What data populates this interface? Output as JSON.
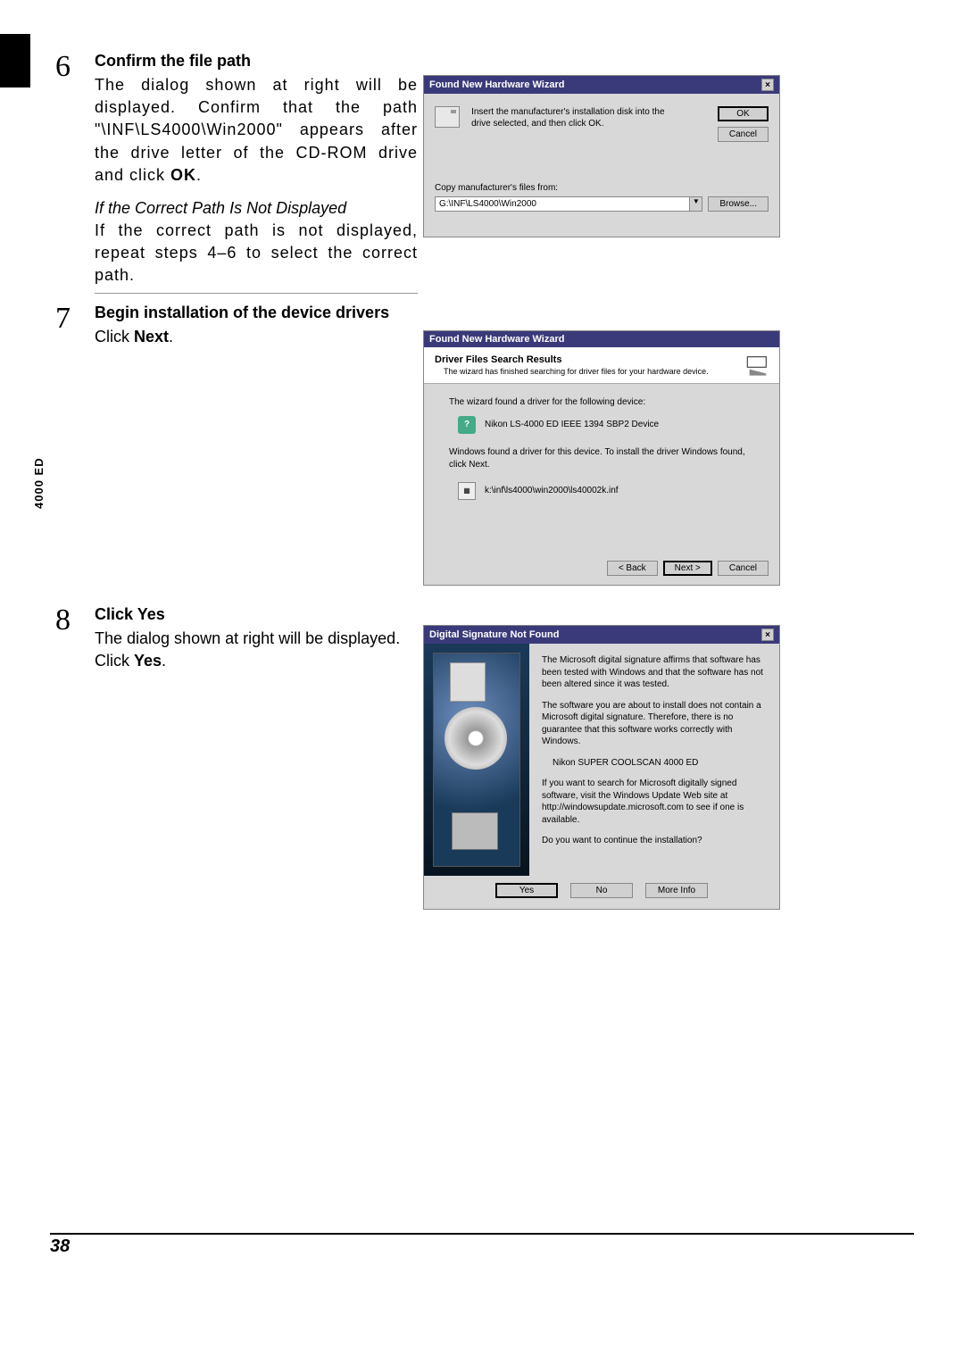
{
  "side_label": "4000 ED",
  "page_number": "38",
  "step6": {
    "num": "6",
    "title": "Confirm the file path",
    "body_prefix": "The dialog shown at right will be displayed. Confirm that the path \"\\INF\\LS4000\\Win2000\" appears after the drive letter of the CD-ROM drive and click ",
    "body_bold": "OK",
    "body_suffix": ".",
    "italic_heading": "If the Correct Path Is Not Displayed",
    "italic_body": "If the correct path is not displayed, repeat steps 4–6 to select the correct path."
  },
  "step7": {
    "num": "7",
    "title": "Begin installation of the device drivers",
    "body_prefix": "Click ",
    "body_bold": "Next",
    "body_suffix": "."
  },
  "step8": {
    "num": "8",
    "title_prefix": "Click ",
    "title_bold": "Yes",
    "body_prefix": "The dialog shown at right will be displayed. Click ",
    "body_bold": "Yes",
    "body_suffix": "."
  },
  "dlg1": {
    "title": "Found New Hardware Wizard",
    "instruction": "Insert the manufacturer's installation disk into the drive selected, and then click OK.",
    "ok": "OK",
    "cancel": "Cancel",
    "copy_label": "Copy manufacturer's files from:",
    "path_value": "G:\\INF\\LS4000\\Win2000",
    "browse": "Browse..."
  },
  "dlg2": {
    "title": "Found New Hardware Wizard",
    "header_title": "Driver Files Search Results",
    "header_sub": "The wizard has finished searching for driver files for your hardware device.",
    "found_text": "The wizard found a driver for the following device:",
    "device_name": "Nikon   LS-4000 ED      IEEE 1394 SBP2 Device",
    "install_text": "Windows found a driver for this device. To install the driver Windows found, click Next.",
    "inf_path": "k:\\inf\\ls4000\\win2000\\ls40002k.inf",
    "back": "< Back",
    "next": "Next >",
    "cancel": "Cancel"
  },
  "dlg3": {
    "title": "Digital Signature Not Found",
    "p1": "The Microsoft digital signature affirms that software has been tested with Windows and that the software has not been altered since it was tested.",
    "p2": "The software you are about to install does not contain a Microsoft digital signature. Therefore, there is no guarantee that this software works correctly with Windows.",
    "product": "Nikon SUPER COOLSCAN 4000 ED",
    "p3": "If you want to search for Microsoft digitally signed software, visit the Windows Update Web site at http://windowsupdate.microsoft.com to see if one is available.",
    "p4": "Do you want to continue the installation?",
    "yes": "Yes",
    "no": "No",
    "more_info": "More Info"
  }
}
